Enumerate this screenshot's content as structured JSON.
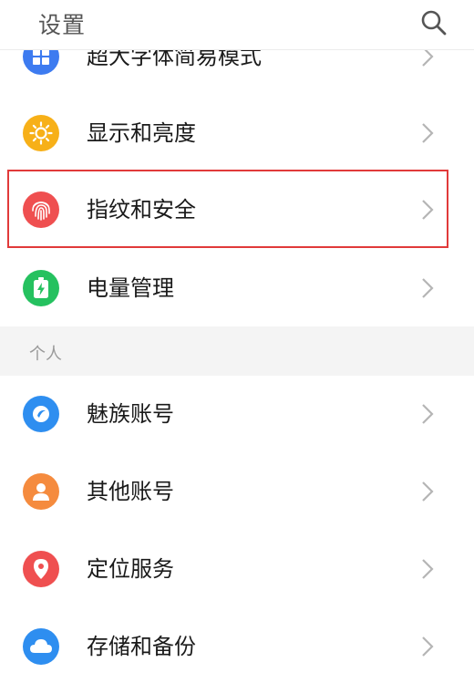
{
  "header": {
    "title": "设置",
    "search_icon": "search-icon"
  },
  "items": [
    {
      "label": "超大字体简易模式",
      "icon": "grid-icon",
      "color": "#3d7bf0"
    },
    {
      "label": "显示和亮度",
      "icon": "sun-icon",
      "color": "#f7b018"
    },
    {
      "label": "指纹和安全",
      "icon": "fingerprint-icon",
      "color": "#ef4f50"
    },
    {
      "label": "电量管理",
      "icon": "battery-icon",
      "color": "#25c15f"
    }
  ],
  "section": {
    "label": "个人"
  },
  "personal": [
    {
      "label": "魅族账号",
      "icon": "meizu-icon",
      "color": "#2e8ef0"
    },
    {
      "label": "其他账号",
      "icon": "user-icon",
      "color": "#f58b3e"
    },
    {
      "label": "定位服务",
      "icon": "location-icon",
      "color": "#ef4f50"
    },
    {
      "label": "存储和备份",
      "icon": "cloud-icon",
      "color": "#2e8ef0"
    }
  ],
  "highlight": {
    "target": "指纹和安全",
    "color": "#e13a3a"
  }
}
